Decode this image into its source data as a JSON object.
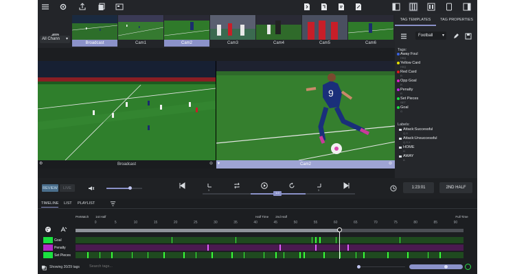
{
  "toolbar": {
    "left_icons": [
      "menu-icon",
      "gear-icon",
      "share-icon",
      "copy-icon",
      "screen-icon"
    ],
    "doc_icons": [
      "doc1-icon",
      "doc2-icon",
      "doc3-icon",
      "doc4-icon"
    ],
    "right_icons": [
      "panel-left-icon",
      "panel-grid-icon",
      "panel-three-icon",
      "tablet-icon",
      "panel-right-icon"
    ]
  },
  "cameras": {
    "all_channels": "All Chann",
    "thumbs": [
      {
        "label": "Broadcast",
        "selected": true
      },
      {
        "label": "Cam1",
        "selected": false
      },
      {
        "label": "Cam2",
        "selected": true
      },
      {
        "label": "Cam3",
        "selected": false
      },
      {
        "label": "Cam4",
        "selected": false
      },
      {
        "label": "Cam5",
        "selected": false
      },
      {
        "label": "Cam6",
        "selected": false
      }
    ]
  },
  "videos": {
    "left_label": "Broadcast",
    "right_label": "Cam2",
    "player_number": "9"
  },
  "panel": {
    "tab_templates": "TAG TEMPLATES",
    "tab_properties": "TAG PROPERTIES",
    "sport": "Football",
    "tags_title": "Tags:",
    "tags": [
      {
        "name": "Away Foul",
        "sub": "H0Q",
        "color": "#3a63e0"
      },
      {
        "name": "Yellow Card",
        "sub": "H0Q",
        "color": "#e6e000"
      },
      {
        "name": "Red Card",
        "sub": "R",
        "color": "#e01b1b"
      },
      {
        "name": "Opp Goal",
        "sub": "R",
        "color": "#e020c8"
      },
      {
        "name": "Penalty",
        "sub": "R",
        "color": "#c02ae0"
      },
      {
        "name": "Set Pieces",
        "sub": "SET",
        "color": "#1be040"
      },
      {
        "name": "Goal",
        "sub": "G",
        "color": "#1be040"
      }
    ],
    "labels_title": "Labels:",
    "labels": [
      {
        "name": "Attack:Successful",
        "sub": "Q,S"
      },
      {
        "name": "Attack:Unsuccessful",
        "sub": "Q,S,X"
      },
      {
        "name": "HOME",
        "sub": "H"
      },
      {
        "name": "AWAY",
        "sub": "A"
      }
    ]
  },
  "controls": {
    "review": "REVIEW",
    "live": "LIVE",
    "volume": 0.65,
    "playback_rate": "1.0",
    "speed_left": "5",
    "speed_right": "5",
    "clock": "1:23:01",
    "half": "2ND HALF"
  },
  "timeline": {
    "tabs": [
      "TIMELINE",
      "LIST",
      "PLAYLIST"
    ],
    "periods": [
      {
        "label": "PreMatch",
        "at": 0
      },
      {
        "label": "1st Half",
        "at": 5
      },
      {
        "label": "Half Time",
        "at": 45
      },
      {
        "label": "2nd Half",
        "at": 50
      },
      {
        "label": "Full Time",
        "at": 95
      }
    ],
    "ticks": [
      0,
      5,
      10,
      15,
      20,
      25,
      30,
      35,
      40,
      45,
      50,
      55,
      60,
      65,
      70,
      75,
      80,
      85,
      90
    ],
    "tracks": [
      {
        "name": "Goal",
        "color": "#1be040",
        "row_color": "#1f4a1f",
        "marks": [
          24,
          40,
          59,
          60,
          61,
          65,
          81
        ],
        "mark_color": "#39ff39"
      },
      {
        "name": "Penalty",
        "color": "#b429c8",
        "row_color": "#4a1a50",
        "marks": [
          33,
          51,
          60,
          68
        ],
        "mark_color": "#e05cff"
      },
      {
        "name": "Set Pieces",
        "color": "#1be040",
        "row_color": "#1f4a1f",
        "marks": [
          3,
          6,
          9,
          14,
          18,
          22,
          27,
          30,
          34,
          39,
          42,
          47,
          50,
          52,
          56,
          57,
          62,
          66,
          70,
          72,
          78,
          83,
          88,
          91
        ],
        "mark_color": "#39ff39"
      }
    ],
    "playhead": 66,
    "showing": "Showing 20/29 tags",
    "search_placeholder": "Search tags..."
  }
}
